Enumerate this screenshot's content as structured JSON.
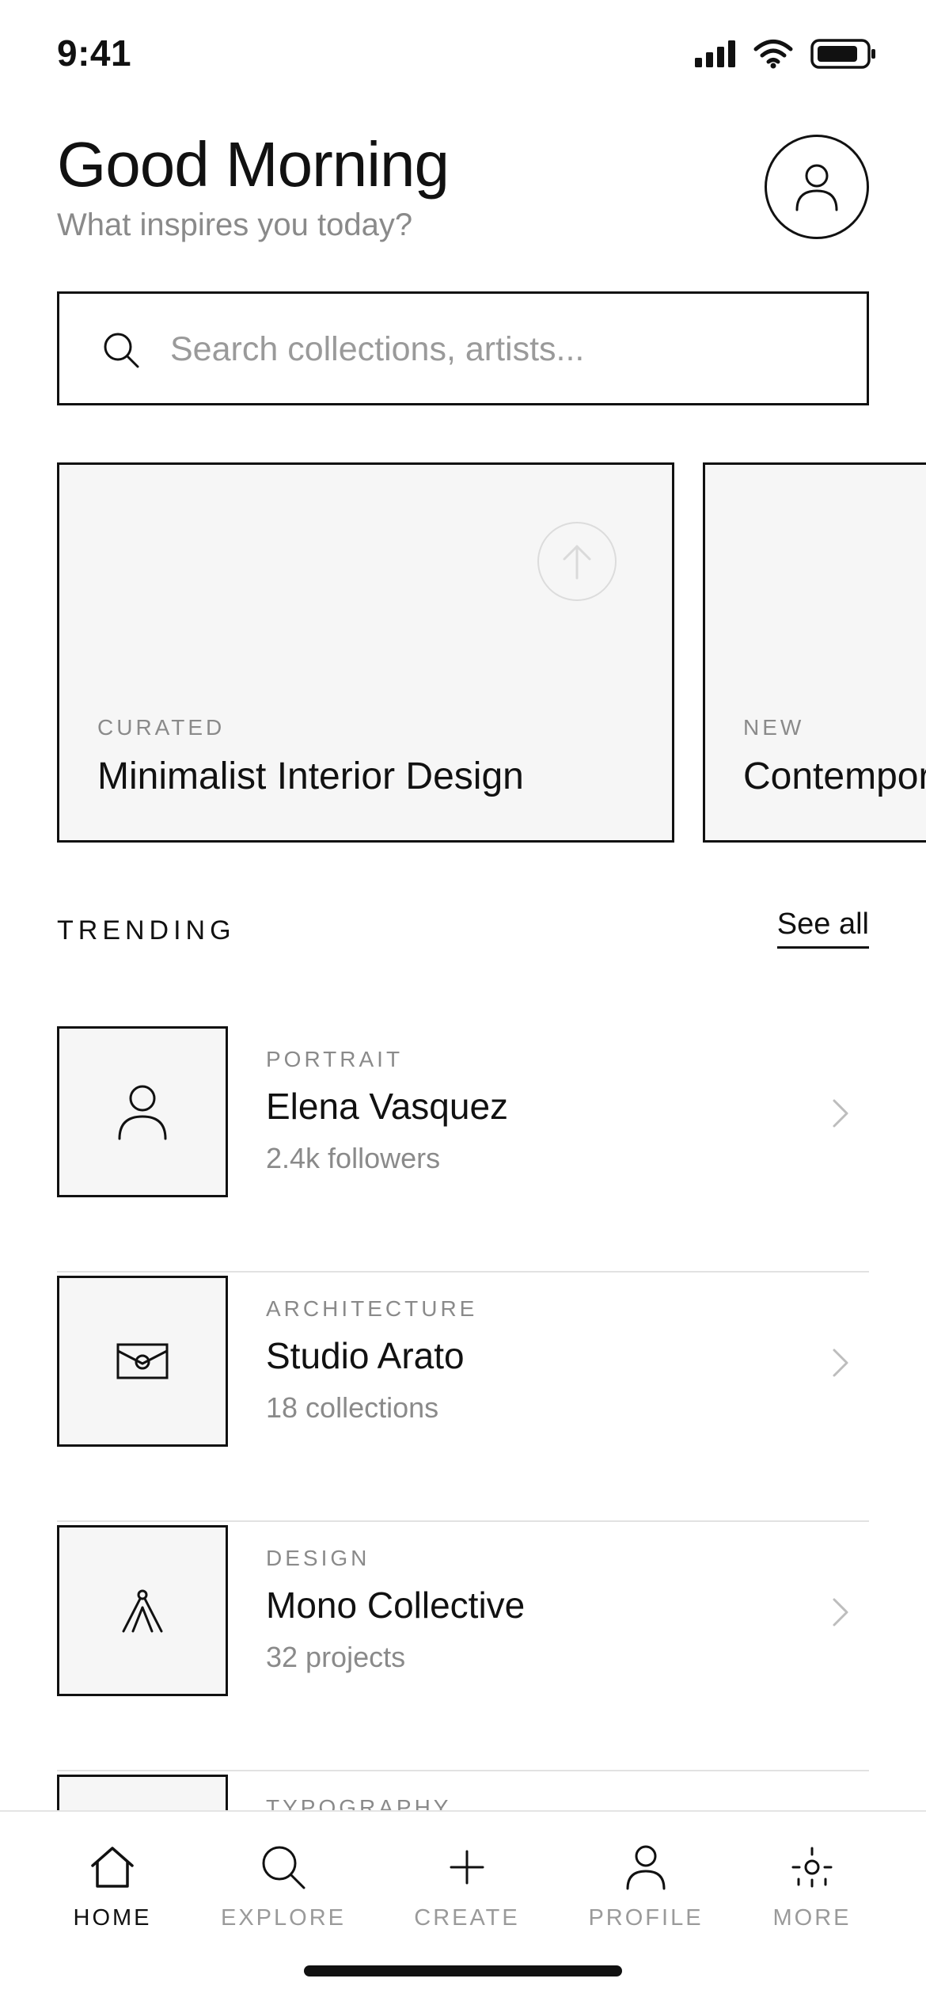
{
  "status_bar": {
    "time": "9:41"
  },
  "header": {
    "greeting": "Good Morning",
    "subtitle": "What inspires you today?"
  },
  "search": {
    "placeholder": "Search collections, artists...",
    "value": ""
  },
  "featured": [
    {
      "tag": "CURATED",
      "title": "Minimalist Interior Design"
    },
    {
      "tag": "NEW",
      "title": "Contempor"
    }
  ],
  "trending": {
    "title": "TRENDING",
    "see_all": "See all",
    "items": [
      {
        "category": "PORTRAIT",
        "name": "Elena Vasquez",
        "meta": "2.4k followers",
        "icon": "person-icon"
      },
      {
        "category": "ARCHITECTURE",
        "name": "Studio Arato",
        "meta": "18 collections",
        "icon": "envelope-icon"
      },
      {
        "category": "DESIGN",
        "name": "Mono Collective",
        "meta": "32 projects",
        "icon": "compass-icon"
      },
      {
        "category": "TYPOGRAPHY",
        "name": "",
        "meta": "",
        "icon": ""
      }
    ]
  },
  "nav": {
    "active": "home",
    "items": [
      {
        "id": "home",
        "label": "HOME",
        "icon": "home-icon"
      },
      {
        "id": "explore",
        "label": "EXPLORE",
        "icon": "search-icon"
      },
      {
        "id": "create",
        "label": "CREATE",
        "icon": "plus-icon"
      },
      {
        "id": "profile",
        "label": "PROFILE",
        "icon": "person-icon"
      },
      {
        "id": "more",
        "label": "MORE",
        "icon": "sun-icon"
      }
    ]
  },
  "colors": {
    "ink": "#111111",
    "muted": "#8a8a8a",
    "surface": "#f6f6f6",
    "divider": "#e2e2e2"
  }
}
